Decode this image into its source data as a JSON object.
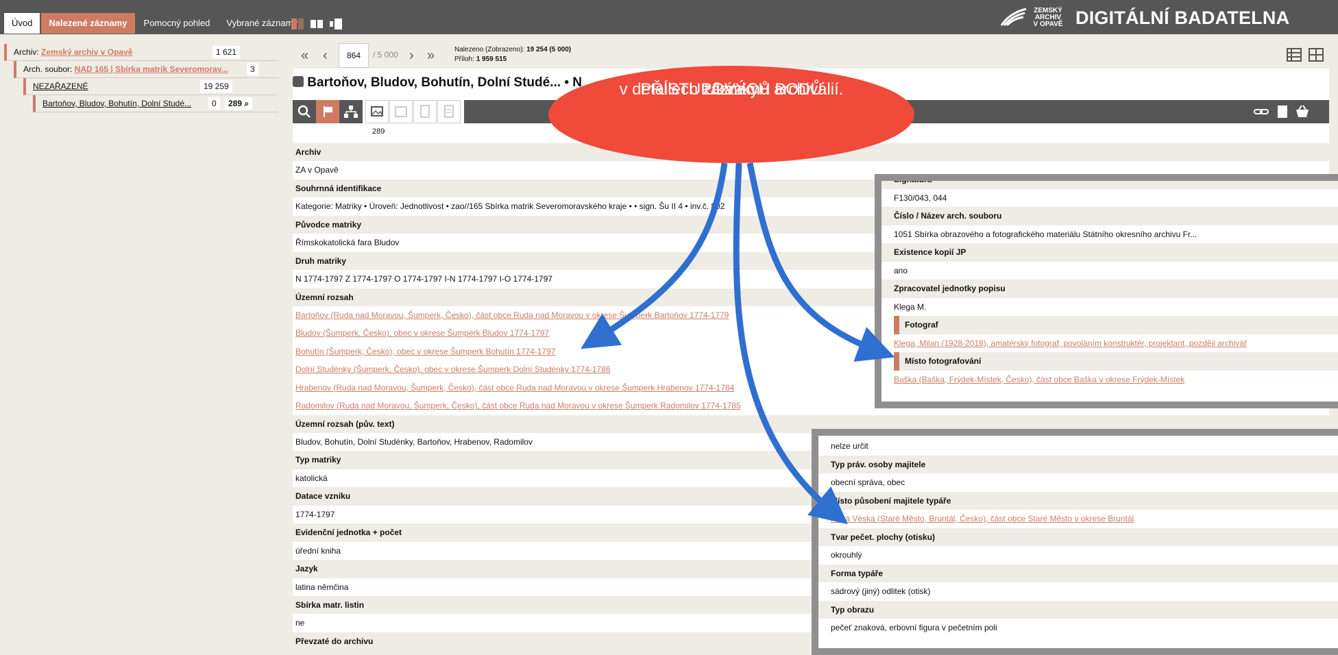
{
  "nav": {
    "tabs": [
      "Úvod",
      "Nalezené záznamy",
      "Pomocný pohled",
      "Vybrané záznamy"
    ],
    "logo_small": [
      "ZEMSKÝ",
      "ARCHIV",
      "V OPAVĚ"
    ],
    "logo_big": "DIGITÁLNÍ BADATELNA"
  },
  "tree": {
    "archiv_label": "Archiv:",
    "archiv_value": "Zemský archiv v Opavě",
    "archiv_count": "1 621",
    "soubor_label": "Arch. soubor:",
    "soubor_value": "NAD 165 | Sbírka matrik Severomorav...",
    "soubor_count": "3",
    "nezarazene": "NEZAŘAZENÉ",
    "nezarazene_count": "19 259",
    "record": "Bartoňov, Bludov, Bohutín, Dolní Studé...",
    "record_count": "0",
    "record_count2": "289"
  },
  "pager": {
    "current": "864",
    "total": "/ 5 000",
    "found_line": "Nalezeno (Zobrazeno):",
    "found_value": "19 254 (5 000)",
    "attach_line": "Příloh:",
    "attach_value": "1 959 515"
  },
  "title": "Bartoňov, Bludov, Bohutín, Dolní Studé... • N",
  "image_count": "289",
  "callout_text": [
    "Ukázky",
    "PŘÍSTUPOVÝCH BODŮ",
    "v detailech záznamů archiválií."
  ],
  "fields": [
    {
      "type": "hd",
      "text": "Archiv"
    },
    {
      "type": "val",
      "text": "ZA v Opavě"
    },
    {
      "type": "hd",
      "text": "Souhrnná identifikace"
    },
    {
      "type": "val",
      "text": "Kategorie: Matriky • Úroveň: Jednotlivost • zao//165 Sbírka matrik Severomoravského kraje • • sign. Šu II 4 • inv.č. 802"
    },
    {
      "type": "hd",
      "text": "Původce matriky"
    },
    {
      "type": "val",
      "text": "Římskokatolická fara Bludov"
    },
    {
      "type": "hd",
      "text": "Druh matriky"
    },
    {
      "type": "val",
      "text": "N 1774-1797 Z 1774-1797 O 1774-1797 I-N 1774-1797 I-O 1774-1797"
    },
    {
      "type": "hd",
      "text": "Územní rozsah"
    },
    {
      "type": "ln",
      "text": "Bartoňov (Ruda nad Moravou, Šumperk, Česko), část obce Ruda nad Moravou v okrese Šumperk Bartoňov 1774-1779"
    },
    {
      "type": "ln",
      "text": "Bludov (Šumperk, Česko), obec v okrese Šumperk Bludov 1774-1797"
    },
    {
      "type": "ln",
      "text": "Bohutín (Šumperk, Česko), obec v okrese Šumperk Bohutín 1774-1797"
    },
    {
      "type": "ln",
      "text": "Dolní Studénky (Šumperk, Česko), obec v okrese Šumperk Dolní Studénky 1774-1786"
    },
    {
      "type": "ln",
      "text": "Hrabenov (Ruda nad Moravou, Šumperk, Česko), část obce Ruda nad Moravou v okrese Šumperk Hrabenov 1774-1784"
    },
    {
      "type": "ln",
      "text": "Radomilov (Ruda nad Moravou, Šumperk, Česko), část obce Ruda nad Moravou v okrese Šumperk Radomilov 1774-1785"
    },
    {
      "type": "hd",
      "text": "Územní rozsah (pův. text)"
    },
    {
      "type": "val",
      "text": "Bludov, Bohutín, Dolní Studénky, Bartoňov, Hrabenov, Radomilov"
    },
    {
      "type": "hd",
      "text": "Typ matriky"
    },
    {
      "type": "val",
      "text": "katolická"
    },
    {
      "type": "hd",
      "text": "Datace vzniku"
    },
    {
      "type": "val",
      "text": "1774-1797"
    },
    {
      "type": "hd",
      "text": "Evidenční jednotka + počet"
    },
    {
      "type": "val",
      "text": "úřední kniha"
    },
    {
      "type": "hd",
      "text": "Jazyk"
    },
    {
      "type": "val",
      "text": "latina němčina"
    },
    {
      "type": "hd",
      "text": "Sbírka matr. listin"
    },
    {
      "type": "val",
      "text": "ne"
    },
    {
      "type": "hd",
      "text": "Převzaté do archivu"
    }
  ],
  "callout1": [
    {
      "type": "hd",
      "text": "Signatura"
    },
    {
      "type": "val",
      "text": "F130/043, 044"
    },
    {
      "type": "hd",
      "text": "Číslo / Název arch. souboru"
    },
    {
      "type": "val",
      "text": "1051 Sbírka obrazového a fotografického materiálu Státního okresního archivu Fr..."
    },
    {
      "type": "hd",
      "text": "Existence kopií JP"
    },
    {
      "type": "val",
      "text": "ano"
    },
    {
      "type": "hd",
      "text": "Zpracovatel jednotky popisu"
    },
    {
      "type": "val",
      "text": "Klega M."
    },
    {
      "type": "hd2",
      "text": "Fotograf"
    },
    {
      "type": "ln",
      "text": "Klega, Milan (1928-2018), amatérský fotograf, povoláním konstruktér, projektant, později archivář"
    },
    {
      "type": "hd2",
      "text": "Místo fotografování"
    },
    {
      "type": "ln",
      "text": "Baška (Baška, Frýdek-Místek, Česko), část obce Baška v okrese Frýdek-Místek"
    }
  ],
  "callout2": [
    {
      "type": "val",
      "text": "nelze určit"
    },
    {
      "type": "hd",
      "text": "Typ práv. osoby majitele"
    },
    {
      "type": "val",
      "text": "obecní správa, obec"
    },
    {
      "type": "hd",
      "text": "Místo působení majitele typáře"
    },
    {
      "type": "ln",
      "text": "Nová Véska (Staré Město, Bruntál, Česko), část obce Staré Město v okrese Bruntál"
    },
    {
      "type": "hd",
      "text": "Tvar pečet. plochy (otisku)"
    },
    {
      "type": "val",
      "text": "okrouhlý"
    },
    {
      "type": "hd",
      "text": "Forma typáře"
    },
    {
      "type": "val",
      "text": "sádrový (jiný) odlitek (otisk)"
    },
    {
      "type": "hd",
      "text": "Typ obrazu"
    },
    {
      "type": "val",
      "text": "pečeť znaková, erbovní figura v pečetním poli"
    }
  ],
  "colors": {
    "accent": "#cf7b63",
    "dark": "#565656",
    "callout": "#ef4a3a",
    "arrow": "#2f6fd0"
  }
}
